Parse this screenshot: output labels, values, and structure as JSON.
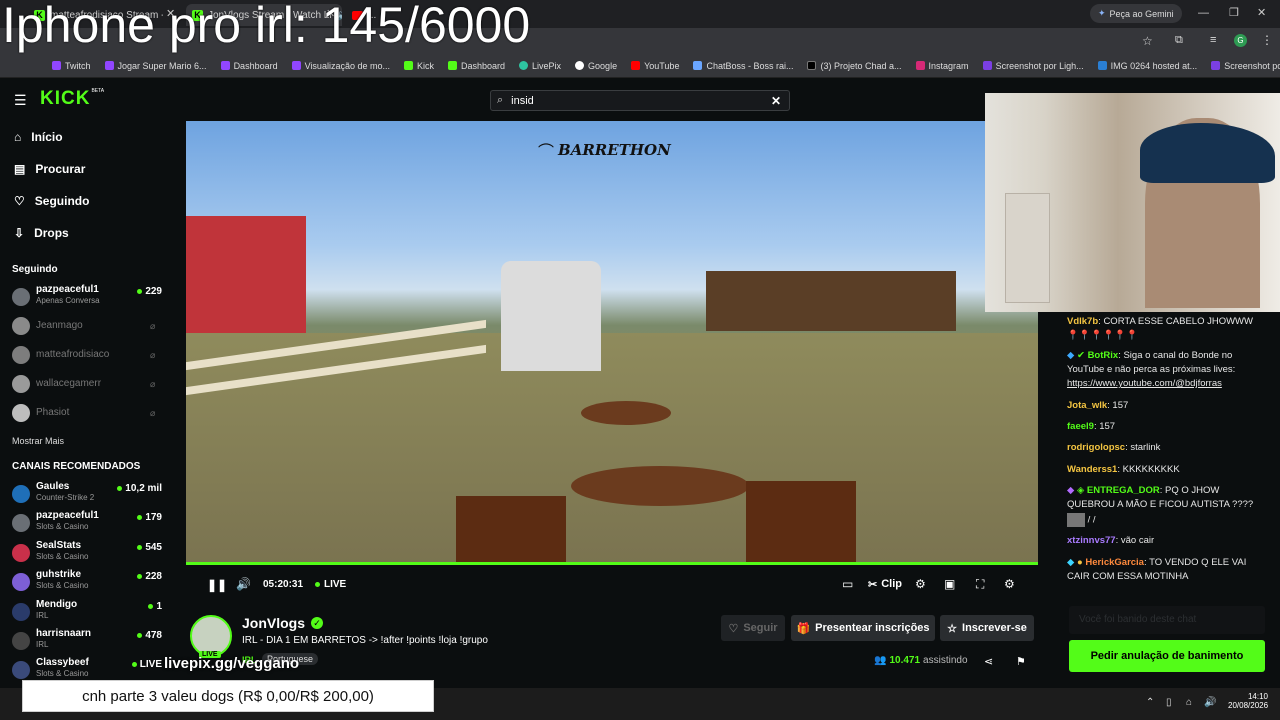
{
  "overlay": {
    "goal_title": "Iphone pro irl: 145/6000",
    "donation_text": "cnh parte 3 valeu dogs (R$ 0,00/R$ 200,00)",
    "livepix_handle": "livepix.gg/veggano"
  },
  "browser": {
    "tabs": [
      {
        "label": "matteafrodisiaco Stream - Watc",
        "icon": "kick-icon"
      },
      {
        "label": "JonVlogs Stream - Watch Li",
        "icon": "kick-icon"
      },
      {
        "label": "...",
        "icon": "youtube-icon"
      }
    ],
    "gemini_label": "Peça ao Gemini",
    "bookmarks": [
      "Twitch",
      "Jogar Super Mario 6...",
      "Dashboard",
      "Visualização de mo...",
      "Kick",
      "Dashboard",
      "LivePix",
      "Google",
      "YouTube",
      "ChatBoss - Boss rai...",
      "(3) Projeto Chad a...",
      "Instagram",
      "Screenshot por Ligh...",
      "IMG 0264 hosted at...",
      "Screenshot por Ligh..."
    ]
  },
  "kick": {
    "logo": "KICK",
    "logo_badge": "BETA",
    "search_value": "insid",
    "nav": [
      {
        "label": "Início",
        "icon": "home-icon"
      },
      {
        "label": "Procurar",
        "icon": "browse-icon"
      },
      {
        "label": "Seguindo",
        "icon": "heart-icon"
      },
      {
        "label": "Drops",
        "icon": "drops-icon"
      }
    ],
    "following_header": "Seguindo",
    "following": [
      {
        "name": "pazpeaceful1",
        "sub": "Apenas Conversa",
        "viewers": "229",
        "live": true
      },
      {
        "name": "Jeanmago",
        "live": false
      },
      {
        "name": "matteafrodisiaco",
        "live": false
      },
      {
        "name": "wallacegamerr",
        "live": false
      },
      {
        "name": "Phasiot",
        "live": false
      }
    ],
    "show_more": "Mostrar Mais",
    "recommended_header": "CANAIS RECOMENDADOS",
    "recommended": [
      {
        "name": "Gaules",
        "sub": "Counter-Strike 2",
        "viewers": "10,2 mil"
      },
      {
        "name": "pazpeaceful1",
        "sub": "Slots & Casino",
        "viewers": "179"
      },
      {
        "name": "SealStats",
        "sub": "Slots & Casino",
        "viewers": "545"
      },
      {
        "name": "guhstrike",
        "sub": "Slots & Casino",
        "viewers": "228"
      },
      {
        "name": "Mendigo",
        "sub": "IRL",
        "viewers": "1"
      },
      {
        "name": "harrisnaarn",
        "sub": "IRL",
        "viewers": "478"
      },
      {
        "name": "Classybeef",
        "sub": "Slots & Casino",
        "viewers": "LIVE"
      }
    ]
  },
  "video": {
    "brand": "BARRETHON",
    "elapsed": "05:20:31",
    "live_label": "LIVE",
    "clip_label": "Clip",
    "progress": 1.0
  },
  "stream": {
    "streamer": "JonVlogs",
    "avatar_badge": "LIVE",
    "title": "IRL - DIA 1 EM BARRETOS -> !after !points !loja !grupo",
    "category": "IRL",
    "language": "Portuguese",
    "follow_label": "Seguir",
    "gift_label": "Presentear inscrições",
    "subscribe_label": "Inscrever-se",
    "viewers": "10.471",
    "viewers_suffix": "assistindo"
  },
  "chat": {
    "messages": [
      {
        "user": "Vdlk7b",
        "text": "CORTA ESSE CABELO JHOWWW",
        "color": "#f4c542"
      },
      {
        "user": "",
        "text": "📍📍📍📍📍📍",
        "color": "#e8e8e8"
      },
      {
        "user": "BotRix",
        "text": "Siga o canal do Bonde no YouTube e não perca as próximas lives:",
        "color": "#53fc18"
      },
      {
        "user": "",
        "text": "https://www.youtube.com/@bdjforras",
        "color": "#e8e8e8"
      },
      {
        "user": "Jota_wlk",
        "text": "157",
        "color": "#f4c542"
      },
      {
        "user": "faeel9",
        "text": "157",
        "color": "#53fc18"
      },
      {
        "user": "rodrigolopsc",
        "text": "starlink",
        "color": "#f4c542"
      },
      {
        "user": "Wanderss1",
        "text": "KKKKKKKKK",
        "color": "#f4c542"
      },
      {
        "user": "ENTREGA_DOR",
        "text": "PQ O JHOW QUEBROU A MÃO E FICOU AUTISTA ????",
        "color": "#53fc18"
      },
      {
        "user": "",
        "text": "/ /",
        "color": "#e8e8e8"
      },
      {
        "user": "xtzinnvs77",
        "text": "vão cair",
        "color": "#a97bff"
      },
      {
        "user": "HerickGarcia",
        "text": "TO VENDO Q ELE VAI CAIR COM ESSA MOTINHA",
        "color": "#ff8a3d"
      }
    ],
    "input_placeholder": "Você foi banido deste chat",
    "unban_label": "Pedir anulação de banimento"
  },
  "taskbar": {
    "time": "14:10",
    "date": "20/08/2026"
  }
}
